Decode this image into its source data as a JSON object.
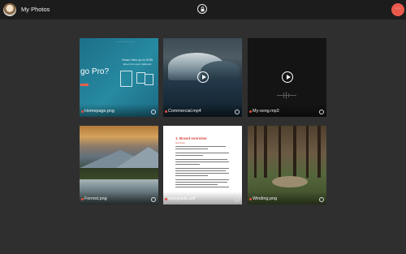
{
  "header": {
    "title": "My Photos",
    "avatar_icon": "user-avatar",
    "center_icon": "lock-icon",
    "menu_icon": "more-horizontal-icon",
    "menu_glyph": "···",
    "accent_color": "#ea5a4c"
  },
  "tiles": [
    {
      "name": "Homepage.png",
      "kind": "image",
      "icon": "info-icon"
    },
    {
      "name": "Commercial.mp4",
      "kind": "video",
      "icon": "info-icon"
    },
    {
      "name": "My-song.mp3",
      "kind": "audio",
      "icon": "info-icon"
    },
    {
      "name": "Forrest.png",
      "kind": "image",
      "icon": "info-icon"
    },
    {
      "name": "styleguide.pdf",
      "kind": "document",
      "icon": "info-icon"
    },
    {
      "name": "Winding.png",
      "kind": "image",
      "icon": "info-icon"
    }
  ],
  "homepage_preview": {
    "headline": "go Pro?",
    "share_text": "Share files up to 5GB",
    "share_sub": "(Even from your mattress)"
  },
  "document_preview": {
    "heading": "1. Brand overview",
    "subheading": "Summary"
  }
}
